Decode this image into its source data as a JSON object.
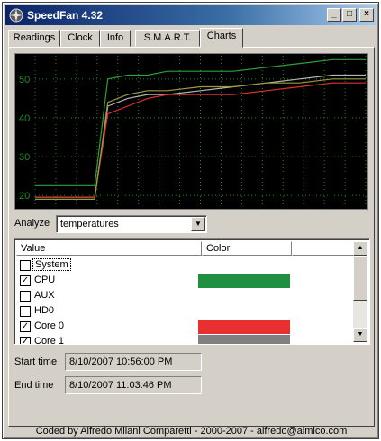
{
  "window": {
    "title": "SpeedFan 4.32"
  },
  "title_buttons": {
    "minimize": "_",
    "maximize": "□",
    "close": "×"
  },
  "tabs": [
    {
      "label": "Readings"
    },
    {
      "label": "Clock"
    },
    {
      "label": "Info"
    },
    {
      "label": "S.M.A.R.T."
    },
    {
      "label": "Charts",
      "active": true
    }
  ],
  "chart_data": {
    "type": "line",
    "background": "#000000",
    "grid": true,
    "grid_color": "#1e8c1e",
    "ylim": [
      17,
      56
    ],
    "y_ticks": [
      20,
      30,
      40,
      50
    ],
    "y_tick_labels": [
      "20",
      "30",
      "40",
      "50"
    ],
    "x": [
      0,
      10,
      18,
      22,
      28,
      34,
      40,
      50,
      60,
      70,
      80,
      90,
      100
    ],
    "series": [
      {
        "color": "#2e9e3e",
        "values": [
          22.5,
          22.5,
          22.5,
          50,
          51,
          51,
          52,
          52,
          52,
          53,
          54,
          55,
          55
        ]
      },
      {
        "color": "#b8b8b8",
        "values": [
          19.5,
          19.5,
          19.5,
          43,
          45,
          46,
          46,
          47,
          48,
          49,
          50,
          51,
          51
        ]
      },
      {
        "color": "#e03030",
        "values": [
          19.5,
          19.5,
          19.5,
          41,
          43,
          45,
          46,
          46,
          46,
          47,
          48,
          49,
          49
        ]
      },
      {
        "color": "#9a9a40",
        "values": [
          19,
          19,
          19,
          44,
          46,
          47,
          47,
          48,
          48,
          49,
          49,
          50,
          50
        ]
      }
    ]
  },
  "analyze": {
    "label": "Analyze",
    "value": "temperatures"
  },
  "listview": {
    "columns": [
      "Value",
      "Color"
    ],
    "rows": [
      {
        "label": "System",
        "checked": false,
        "color": null,
        "focused": true
      },
      {
        "label": "CPU",
        "checked": true,
        "color": "#1e9040"
      },
      {
        "label": "AUX",
        "checked": false,
        "color": null
      },
      {
        "label": "HD0",
        "checked": false,
        "color": null
      },
      {
        "label": "Core 0",
        "checked": true,
        "color": "#e83030"
      },
      {
        "label": "Core 1",
        "checked": true,
        "color": "#808080"
      }
    ]
  },
  "times": {
    "start_label": "Start time",
    "start_value": "8/10/2007 10:56:00 PM",
    "end_label": "End time",
    "end_value": "8/10/2007 11:03:46 PM"
  },
  "footer": "Coded by Alfredo Milani Comparetti - 2000-2007 - alfredo@almico.com"
}
